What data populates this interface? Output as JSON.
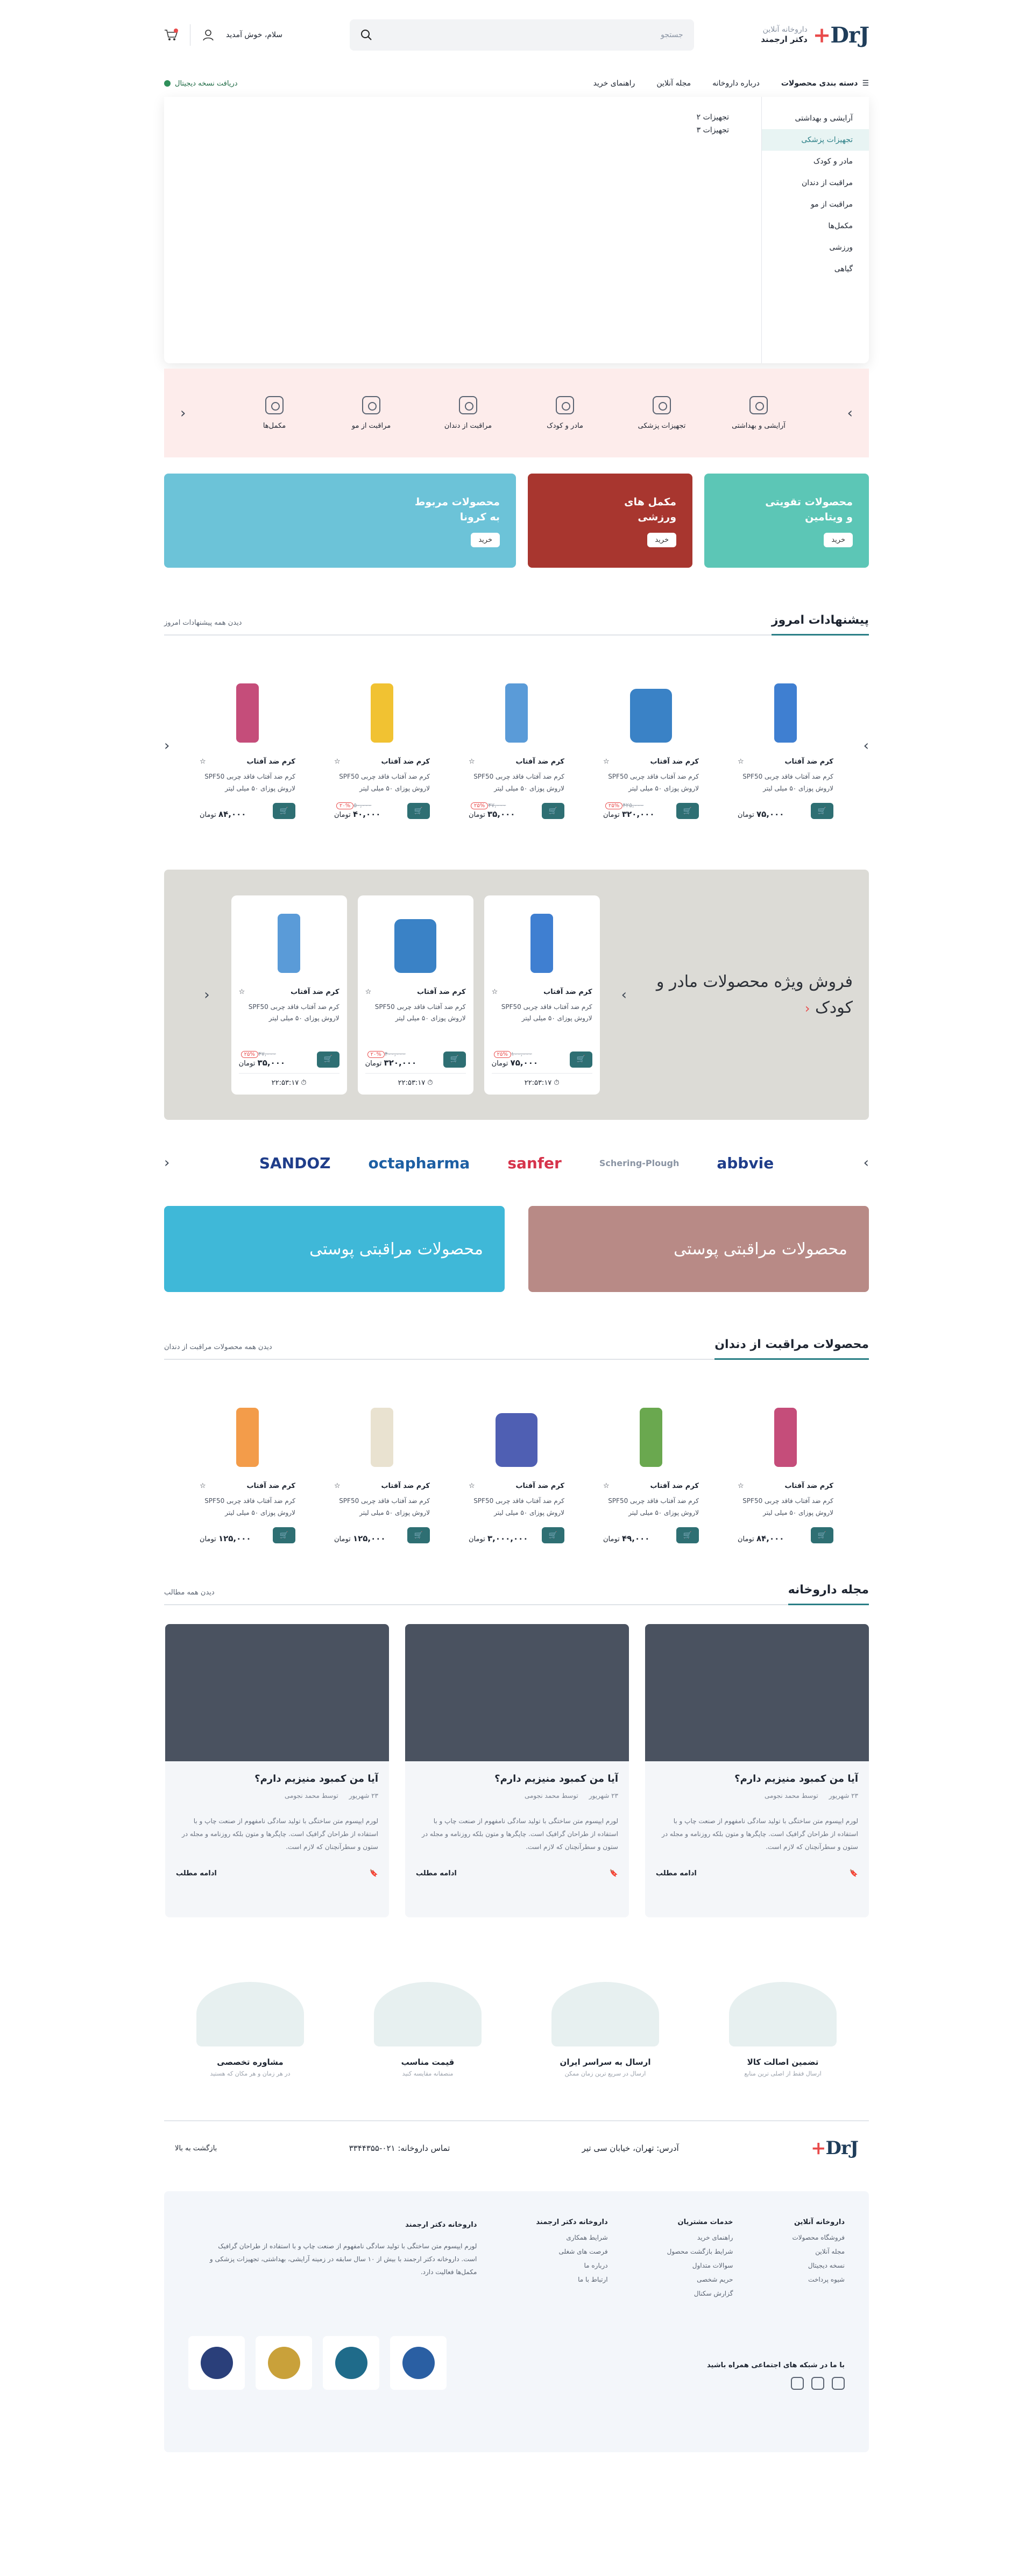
{
  "header": {
    "logo_text": "DrJ",
    "logo_plus": "+",
    "store_sub": "داروخانه آنلاین",
    "store_name": "دکتر ارجمند",
    "search_placeholder": "جستجو",
    "greeting": "سلام، خوش آمدید"
  },
  "nav": {
    "categories": "دسته بندی محصولات",
    "links": [
      "درباره داروخانه",
      "مجله آنلاین",
      "راهنمای خرید"
    ],
    "digital": "دریافت نسخه دیجیتال"
  },
  "mega": {
    "items": [
      "آرایشی و بهداشتی",
      "تجهیزات پزشکی",
      "مادر و کودک",
      "مراقبت از دندان",
      "مراقبت از مو",
      "مکمل‌ها",
      "ورزشی",
      "گیاهی"
    ],
    "active": 1,
    "sub": [
      "تجهیزات ۲",
      "تجهیزات ۳"
    ]
  },
  "catstrip": [
    "آرایشی و بهداشتی",
    "تجهیزات پزشکی",
    "مادر و کودک",
    "مراقبت از دندان",
    "مراقبت از مو",
    "مکمل‌ها"
  ],
  "promos": [
    {
      "title": "محصولات تقویتی و ویتامین",
      "btn": "خرید",
      "bg": "#5cc6b6"
    },
    {
      "title": "مکمل های ورزشی",
      "btn": "خرید",
      "bg": "#a8362f"
    },
    {
      "title": "محصولات مربوط به کرونا",
      "btn": "خرید",
      "bg": "#6cc3d8"
    }
  ],
  "today": {
    "title": "پیشنهادات امروز",
    "link": "دیدن همه پیشنهادات امروز"
  },
  "product": {
    "name": "کرم ضد آفتاب",
    "desc": "کرم ضد آفتاب فاقد چربی SPF50 لاروش پوزای ۵۰ میلی لیتر",
    "currency": "تومان",
    "cart": "🛒"
  },
  "today_items": [
    {
      "price": "۷۵,۰۰۰",
      "old": "",
      "off": "",
      "color": "#3f7fd1"
    },
    {
      "price": "۳۲۰,۰۰۰",
      "old": "۴۲۵,۰۰۰",
      "off": "۲۵%",
      "color": "#3a82c6"
    },
    {
      "price": "۳۵,۰۰۰",
      "old": "۴۷,۰۰۰",
      "off": "۲۵%",
      "color": "#5a9bd8"
    },
    {
      "price": "۴۰,۰۰۰",
      "old": "۵۰,۰۰۰",
      "off": "۲۰%",
      "color": "#f1c232"
    },
    {
      "price": "۸۴,۰۰۰",
      "old": "",
      "off": "",
      "color": "#c54d7a"
    }
  ],
  "special": {
    "title": "فروش ویژه محصولات مادر و کودک",
    "items": [
      {
        "price": "۷۵,۰۰۰",
        "old": "۱۰۰,۰۰۰",
        "off": "۲۵%",
        "timer": "۲۲:۵۳:۱۷",
        "color": "#3f7fd1"
      },
      {
        "price": "۳۲۰,۰۰۰",
        "old": "۴۰۰,۰۰۰",
        "off": "۲۰%",
        "timer": "۲۲:۵۳:۱۷",
        "color": "#3a82c6"
      },
      {
        "price": "۳۵,۰۰۰",
        "old": "۴۷,۰۰۰",
        "off": "۲۵%",
        "timer": "۲۲:۵۳:۱۷",
        "color": "#5a9bd8"
      }
    ]
  },
  "brands": [
    "abbvie",
    "Schering-Plough",
    "sanfer",
    "octapharma",
    "SANDOZ"
  ],
  "skin": [
    {
      "text": "محصولات مراقبتی پوستی",
      "bg": "#b88a86"
    },
    {
      "text": "محصولات مراقبتی پوستی",
      "bg": "#3fb8d8"
    }
  ],
  "dental": {
    "title": "محصولات مراقبت از دندان",
    "link": "دیدن همه محصولات مراقبت از دندان",
    "items": [
      {
        "price": "۸۴,۰۰۰",
        "color": "#c54d7a"
      },
      {
        "price": "۴۹,۰۰۰",
        "color": "#6aa84f"
      },
      {
        "price": "۳,۰۰۰,۰۰۰",
        "color": "#4f5fb3"
      },
      {
        "price": "۱۲۵,۰۰۰",
        "color": "#e9e2d0"
      },
      {
        "price": "۱۲۵,۰۰۰",
        "color": "#f39c4a"
      }
    ]
  },
  "blog": {
    "title": "مجله داروخانه",
    "link": "دیدن همه مطالب",
    "post_title": "آیا من کمبود منیزیم دارم؟",
    "date": "۲۳ شهریور",
    "author": "توسط محمد نجومی",
    "excerpt": "لورم ایپسوم متن ساختگی با تولید سادگی نامفهوم از صنعت چاپ و با استفاده از طراحان گرافیک است. چاپگرها و متون بلکه روزنامه و مجله در ستون و سطرآنچنان که لازم است.",
    "more": "ادامه مطلب"
  },
  "features": [
    {
      "t": "تضمین اصالت کالا",
      "s": "ارسال فقط از اصلی ترین منابع"
    },
    {
      "t": "ارسال به سراسر ایران",
      "s": "ارسال در سریع ترین زمان ممکن"
    },
    {
      "t": "قیمت مناسب",
      "s": "منصفانه مقایسه کنید"
    },
    {
      "t": "مشاوره تخصصی",
      "s": "در هر زمان و هر مکان که هستید"
    }
  ],
  "contact": {
    "address": "آدرس: تهران، خیابان سی تیر",
    "phone": "تماس داروخانه: ۰۲۱-۳۳۴۴۳۵۵",
    "back": "بازگشت به بالا"
  },
  "footer": {
    "cols": [
      {
        "h": "داروخانه آنلاین",
        "items": [
          "فروشگاه محصولات",
          "مجله آنلاین",
          "نسخه دیجیتال",
          "شیوه پرداخت"
        ]
      },
      {
        "h": "خدمات مشتریان",
        "items": [
          "راهنمای خرید",
          "شرایط بازگشت محصول",
          "سوالات متداول",
          "حریم شخصی",
          "گزارش سکنال"
        ]
      },
      {
        "h": "داروخانه دکتر ارجمند",
        "items": [
          "شرایط همکاری",
          "فرصت های شغلی",
          "درباره ما",
          "ارتباط با ما"
        ]
      }
    ],
    "about_h": "داروخانه دکتر ارجمند",
    "about": "لورم ایپسوم متن ساختگی با تولید سادگی نامفهوم از صنعت چاپ و با استفاده از طراحان گرافیک است. داروخانه دکتر ارجمند با بیش از ۱۰ سال سابقه در زمینه آرایشی، بهداشتی، تجهیزات پزشکی و مکمل‌ها فعالیت دارد.",
    "social": "با ما در شبکه های اجتماعی همراه باشید"
  }
}
